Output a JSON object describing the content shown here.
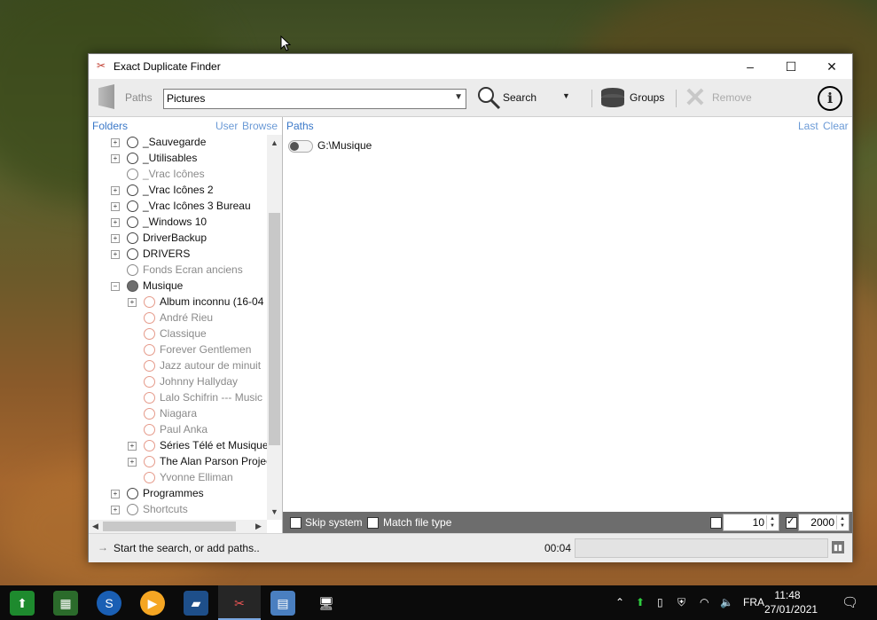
{
  "window": {
    "title": "Exact Duplicate Finder"
  },
  "toolbar": {
    "paths_label": "Paths",
    "combo_value": "Pictures",
    "search_label": "Search",
    "groups_label": "Groups",
    "remove_label": "Remove"
  },
  "folders_panel": {
    "title": "Folders",
    "user_link": "User",
    "browse_link": "Browse",
    "items": [
      {
        "label": "_Sauvegarde"
      },
      {
        "label": "_Utilisables"
      },
      {
        "label": "_Vrac Icônes"
      },
      {
        "label": "_Vrac Icônes 2"
      },
      {
        "label": "_Vrac Icônes 3 Bureau"
      },
      {
        "label": "_Windows 10"
      },
      {
        "label": "DriverBackup"
      },
      {
        "label": "DRIVERS"
      },
      {
        "label": "Fonds Ecran anciens"
      },
      {
        "label": "Musique"
      },
      {
        "label": "Album inconnu (16-04"
      },
      {
        "label": "André Rieu"
      },
      {
        "label": "Classique"
      },
      {
        "label": "Forever Gentlemen"
      },
      {
        "label": "Jazz autour de minuit"
      },
      {
        "label": "Johnny Hallyday"
      },
      {
        "label": "Lalo Schifrin --- Music"
      },
      {
        "label": "Niagara"
      },
      {
        "label": "Paul Anka"
      },
      {
        "label": "Séries Télé et  Musique"
      },
      {
        "label": "The Alan Parson Projec"
      },
      {
        "label": "Yvonne Elliman"
      },
      {
        "label": "Programmes"
      },
      {
        "label": "Shortcuts"
      }
    ]
  },
  "paths_panel": {
    "title": "Paths",
    "last_link": "Last",
    "clear_link": "Clear",
    "items": [
      {
        "path": "G:\\Musique"
      }
    ]
  },
  "options": {
    "skip_system": "Skip system",
    "match_file_type": "Match file type",
    "min_value": "10",
    "max_value": "2000"
  },
  "status": {
    "message": "Start the search, or add paths..",
    "time": "00:04"
  },
  "taskbar": {
    "language": "FRA",
    "time": "11:48",
    "date": "27/01/2021"
  }
}
